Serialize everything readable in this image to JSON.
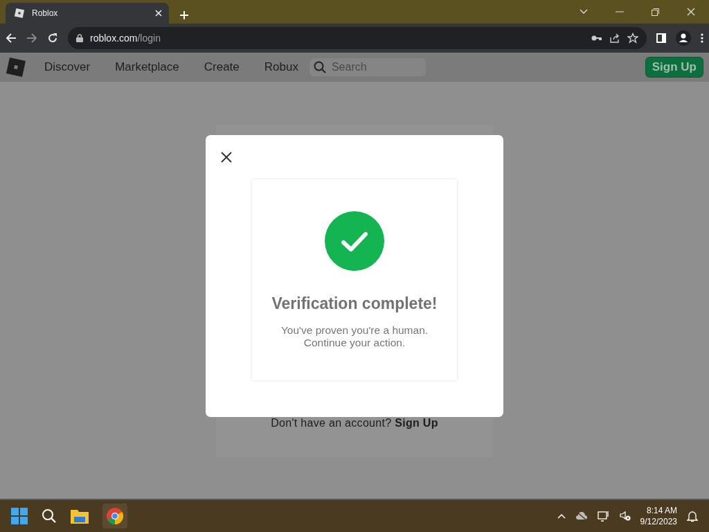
{
  "browser": {
    "tabs": [
      {
        "title": "Roblox",
        "selected": true
      }
    ],
    "address": {
      "domain": "roblox.com",
      "path": "/login"
    }
  },
  "site_nav": {
    "links": [
      "Discover",
      "Marketplace",
      "Create",
      "Robux"
    ],
    "search": {
      "placeholder": "Search"
    },
    "signup_button": "Sign Up"
  },
  "login_card": {
    "prompt": "Don't have an account?",
    "link": "Sign Up"
  },
  "dialog": {
    "title": "Verification complete!",
    "message_lines": [
      "You've proven you're a human.",
      "Continue your action."
    ]
  },
  "taskbar": {
    "time": "8:14 AM",
    "date": "9/12/2023"
  }
}
